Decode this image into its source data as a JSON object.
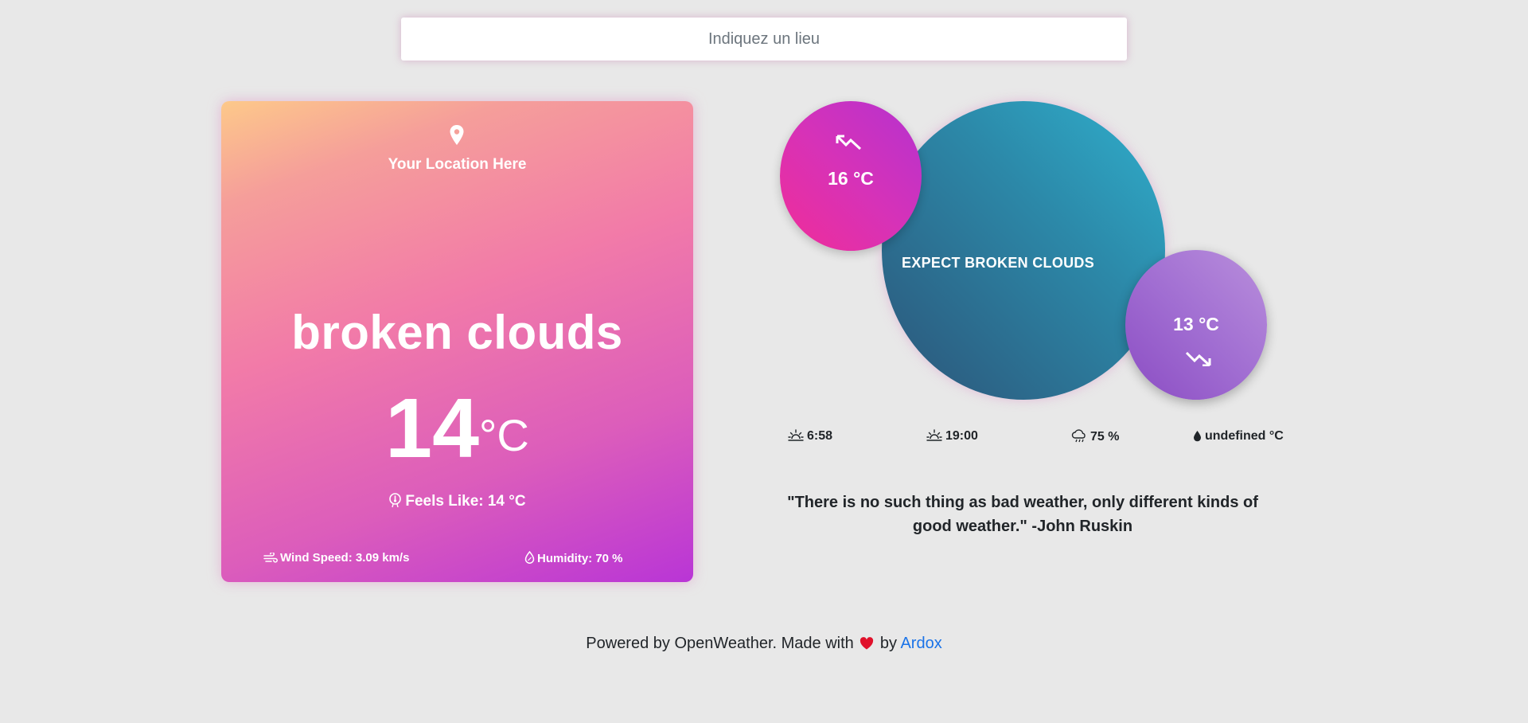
{
  "search": {
    "placeholder": "Indiquez un lieu"
  },
  "card": {
    "location": "Your Location Here",
    "description": "broken clouds",
    "temperature": "14",
    "temperature_unit": "°C",
    "feels_like": "Feels Like: 14 °C",
    "wind_speed": "Wind Speed: 3.09 km/s",
    "humidity": "Humidity: 70 %",
    "icons": [
      "map-pin-icon",
      "thermometer-icon",
      "wind-icon",
      "humidity-drop-icon"
    ]
  },
  "forecast": {
    "text": "EXPECT BROKEN CLOUDS",
    "high": "16 °C",
    "low": "13 °C",
    "icons": [
      "trend-up-icon",
      "trend-down-icon"
    ]
  },
  "stats": {
    "sunrise": "6:58",
    "sunset": "19:00",
    "clouds": "75 %",
    "dew_point": "undefined °C",
    "icons": [
      "sunrise-icon",
      "sunset-icon",
      "cloud-rain-icon",
      "drop-icon"
    ]
  },
  "quote": {
    "text": "\"There is no such thing as bad weather, only different kinds of good weather.\" -John Ruskin"
  },
  "footer": {
    "text_before": "Powered by OpenWeather. Made with",
    "text_by": "by",
    "author_link": "Ardox"
  },
  "colors": {
    "background": "#e8e8e8",
    "card_gradient_start": "#fdc98a",
    "card_gradient_end": "#b935d6",
    "main_bubble": "#2c88a8",
    "high_bubble": "#e22dac",
    "low_bubble": "#a16ed2",
    "heart": "#e0112b",
    "link": "#1a73e8"
  }
}
